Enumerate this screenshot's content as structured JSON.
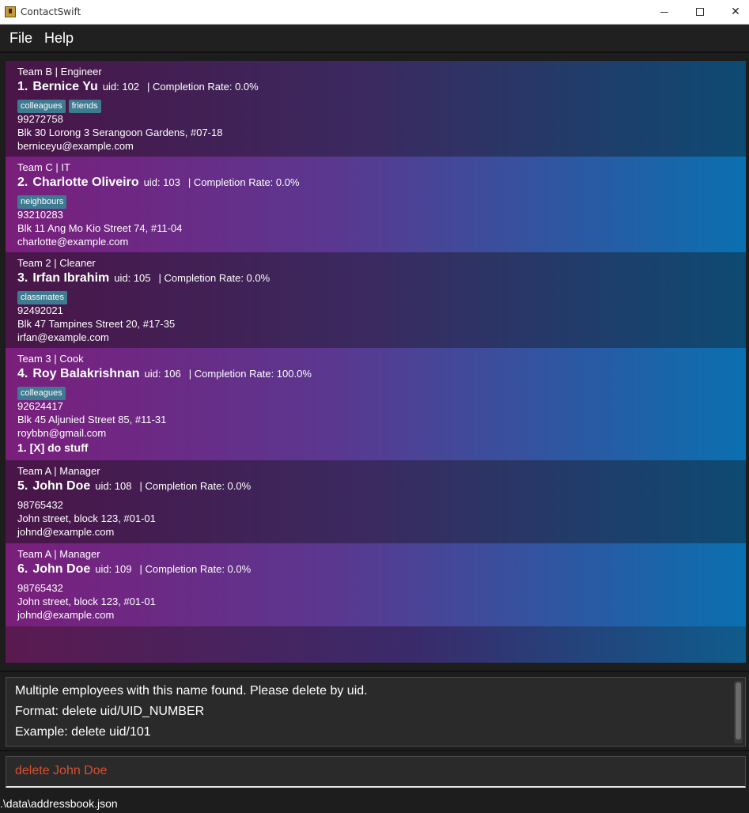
{
  "window": {
    "title": "ContactSwift"
  },
  "menu": {
    "file": "File",
    "help": "Help"
  },
  "employees": [
    {
      "team": "Team B | Engineer",
      "index": "1.",
      "name": "Bernice Yu",
      "uid": "uid: 102",
      "rate": "| Completion Rate: 0.0%",
      "tags": [
        "colleagues",
        "friends"
      ],
      "phone": "99272758",
      "address": "Blk 30 Lorong 3 Serangoon Gardens, #07-18",
      "email": "berniceyu@example.com"
    },
    {
      "team": "Team C | IT",
      "index": "2.",
      "name": "Charlotte Oliveiro",
      "uid": "uid: 103",
      "rate": "| Completion Rate: 0.0%",
      "tags": [
        "neighbours"
      ],
      "phone": "93210283",
      "address": "Blk 11 Ang Mo Kio Street 74, #11-04",
      "email": "charlotte@example.com"
    },
    {
      "team": "Team 2 | Cleaner",
      "index": "3.",
      "name": "Irfan Ibrahim",
      "uid": "uid: 105",
      "rate": "| Completion Rate: 0.0%",
      "tags": [
        "classmates"
      ],
      "phone": "92492021",
      "address": "Blk 47 Tampines Street 20, #17-35",
      "email": "irfan@example.com"
    },
    {
      "team": "Team 3 | Cook",
      "index": "4.",
      "name": "Roy Balakrishnan",
      "uid": "uid: 106",
      "rate": "| Completion Rate: 100.0%",
      "tags": [
        "colleagues"
      ],
      "phone": "92624417",
      "address": "Blk 45 Aljunied Street 85, #11-31",
      "email": "roybbn@gmail.com",
      "task": "1. [X] do stuff"
    },
    {
      "team": "Team A | Manager",
      "index": "5.",
      "name": "John Doe",
      "uid": "uid: 108",
      "rate": "| Completion Rate: 0.0%",
      "tags": [],
      "phone": "98765432",
      "address": "John street, block 123, #01-01",
      "email": "johnd@example.com"
    },
    {
      "team": "Team A | Manager",
      "index": "6.",
      "name": "John Doe",
      "uid": "uid: 109",
      "rate": "| Completion Rate: 0.0%",
      "tags": [],
      "phone": "98765432",
      "address": "John street, block 123, #01-01",
      "email": "johnd@example.com"
    }
  ],
  "result": {
    "line1": "Multiple employees with this name found. Please delete by uid.",
    "line2": "Format: delete uid/UID_NUMBER",
    "line3": "Example: delete uid/101"
  },
  "command": {
    "value": "delete John Doe"
  },
  "status": {
    "path": ".\\data\\addressbook.json"
  }
}
